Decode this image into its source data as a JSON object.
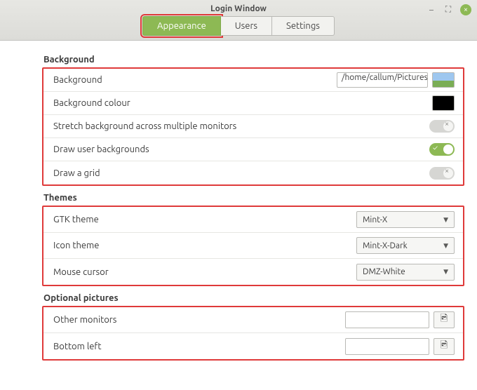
{
  "window": {
    "title": "Login Window"
  },
  "tabs": {
    "appearance": "Appearance",
    "users": "Users",
    "settings": "Settings",
    "active": "appearance"
  },
  "sections": {
    "background": {
      "title": "Background",
      "rows": {
        "background": {
          "label": "Background",
          "value": "/home/callum/Pictures/ca"
        },
        "bg_colour": {
          "label": "Background colour",
          "color": "#000000"
        },
        "stretch": {
          "label": "Stretch background across multiple monitors",
          "on": false
        },
        "user_bg": {
          "label": "Draw user backgrounds",
          "on": true
        },
        "grid": {
          "label": "Draw a grid",
          "on": false
        }
      }
    },
    "themes": {
      "title": "Themes",
      "rows": {
        "gtk": {
          "label": "GTK theme",
          "value": "Mint-X"
        },
        "icon": {
          "label": "Icon theme",
          "value": "Mint-X-Dark"
        },
        "cursor": {
          "label": "Mouse cursor",
          "value": "DMZ-White"
        }
      }
    },
    "optional": {
      "title": "Optional pictures",
      "rows": {
        "other": {
          "label": "Other monitors",
          "value": ""
        },
        "bottom": {
          "label": "Bottom left",
          "value": ""
        }
      }
    }
  }
}
